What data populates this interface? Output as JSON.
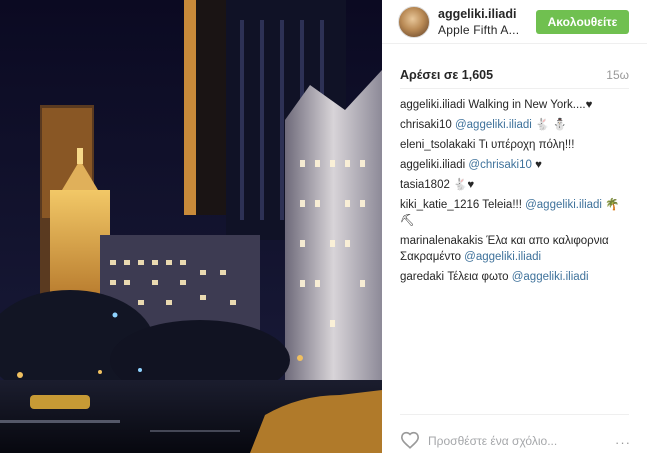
{
  "post": {
    "username": "aggeliki.iliadi",
    "location": "Apple Fifth A...",
    "follow_label": "Ακολουθείτε",
    "likes": "Αρέσει σε 1,605",
    "age": "15ω",
    "comments": [
      {
        "user": "aggeliki.iliadi",
        "mention": "",
        "text": " Walking in New York....",
        "emoji": "♥"
      },
      {
        "user": "chrisaki10",
        "mention": " @aggeliki.iliadi",
        "text": "",
        "emoji": " 🐇 ⛄"
      },
      {
        "user": "eleni_tsolakaki",
        "mention": "",
        "text": " Τι υπέροχη πόλη!!!",
        "emoji": ""
      },
      {
        "user": "aggeliki.iliadi",
        "mention": " @chrisaki10",
        "text": "",
        "emoji": " ♥"
      },
      {
        "user": "tasia1802",
        "mention": "",
        "text": "",
        "emoji": " 🐇♥"
      },
      {
        "user": "kiki_katie_1216",
        "mention": " @aggeliki.iliadi",
        "text": " Teleia!!! ",
        "emoji": " 🌴 ⛏"
      },
      {
        "user": "marinalenakakis",
        "mention": " @aggeliki.iliadi",
        "text": " Έλα και απο καλιφορνια Σακραμέντο",
        "emoji": ""
      },
      {
        "user": "garedaki",
        "mention": " @aggeliki.iliadi",
        "text": " Τέλεια φωτο ",
        "emoji": ""
      }
    ],
    "add_comment_placeholder": "Προσθέστε ένα σχόλιο...",
    "more_label": "···"
  },
  "colors": {
    "follow_bg": "#70c050",
    "mention": "#3f729b"
  },
  "icons": {
    "like": "heart-outline-icon",
    "more": "ellipsis-icon"
  }
}
